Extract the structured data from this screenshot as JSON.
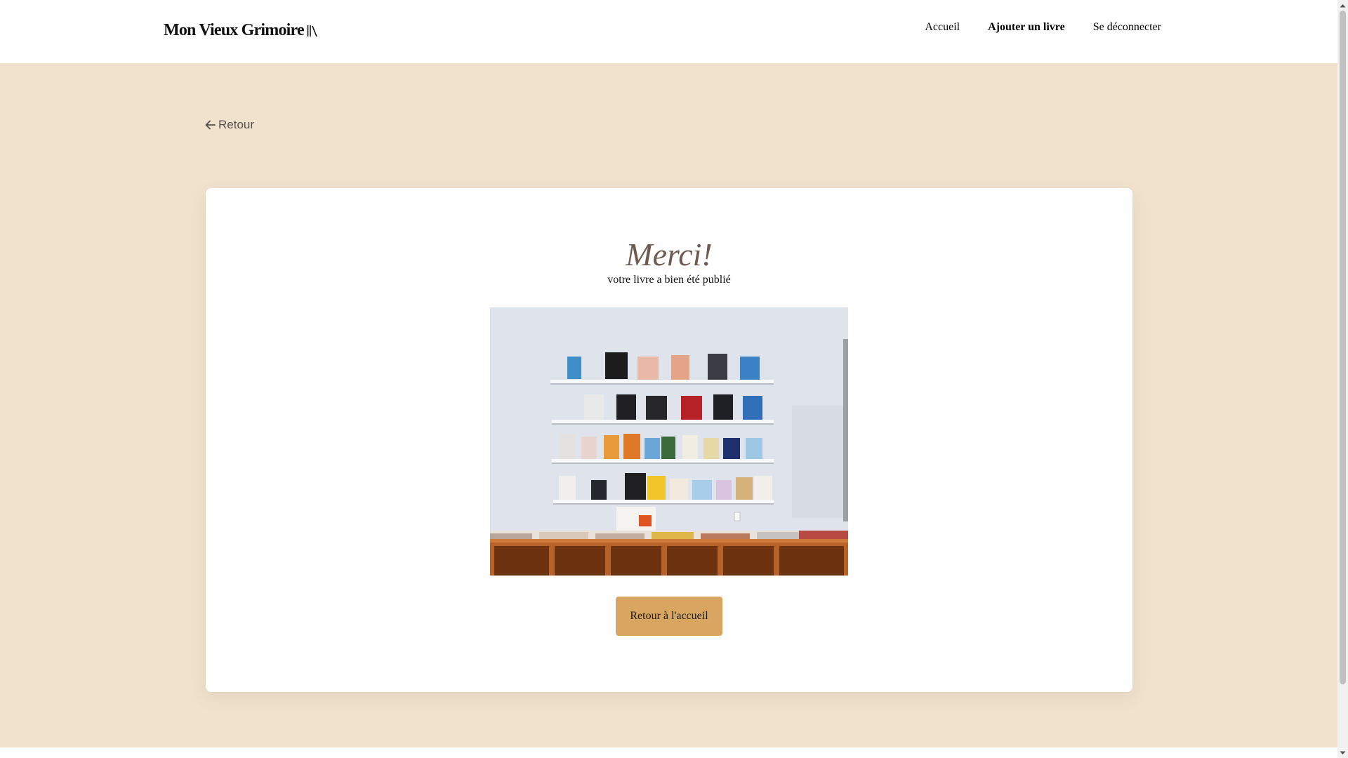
{
  "header": {
    "logo_text": "Mon Vieux Grimoire",
    "nav": [
      {
        "label": "Accueil",
        "active": false
      },
      {
        "label": "Ajouter un livre",
        "active": true
      },
      {
        "label": "Se déconnecter",
        "active": false
      }
    ]
  },
  "main": {
    "back_label": "Retour",
    "confirmation": {
      "title": "Merci!",
      "subtitle": "votre livre a bien été publié",
      "button_label": "Retour à l'accueil"
    }
  },
  "colors": {
    "page_background": "#f0e2cd",
    "card_background": "#ffffff",
    "button_background": "#d8a660",
    "title_color": "#6e5a50"
  },
  "icons": {
    "logo": "books-icon",
    "back": "arrow-left-icon"
  }
}
